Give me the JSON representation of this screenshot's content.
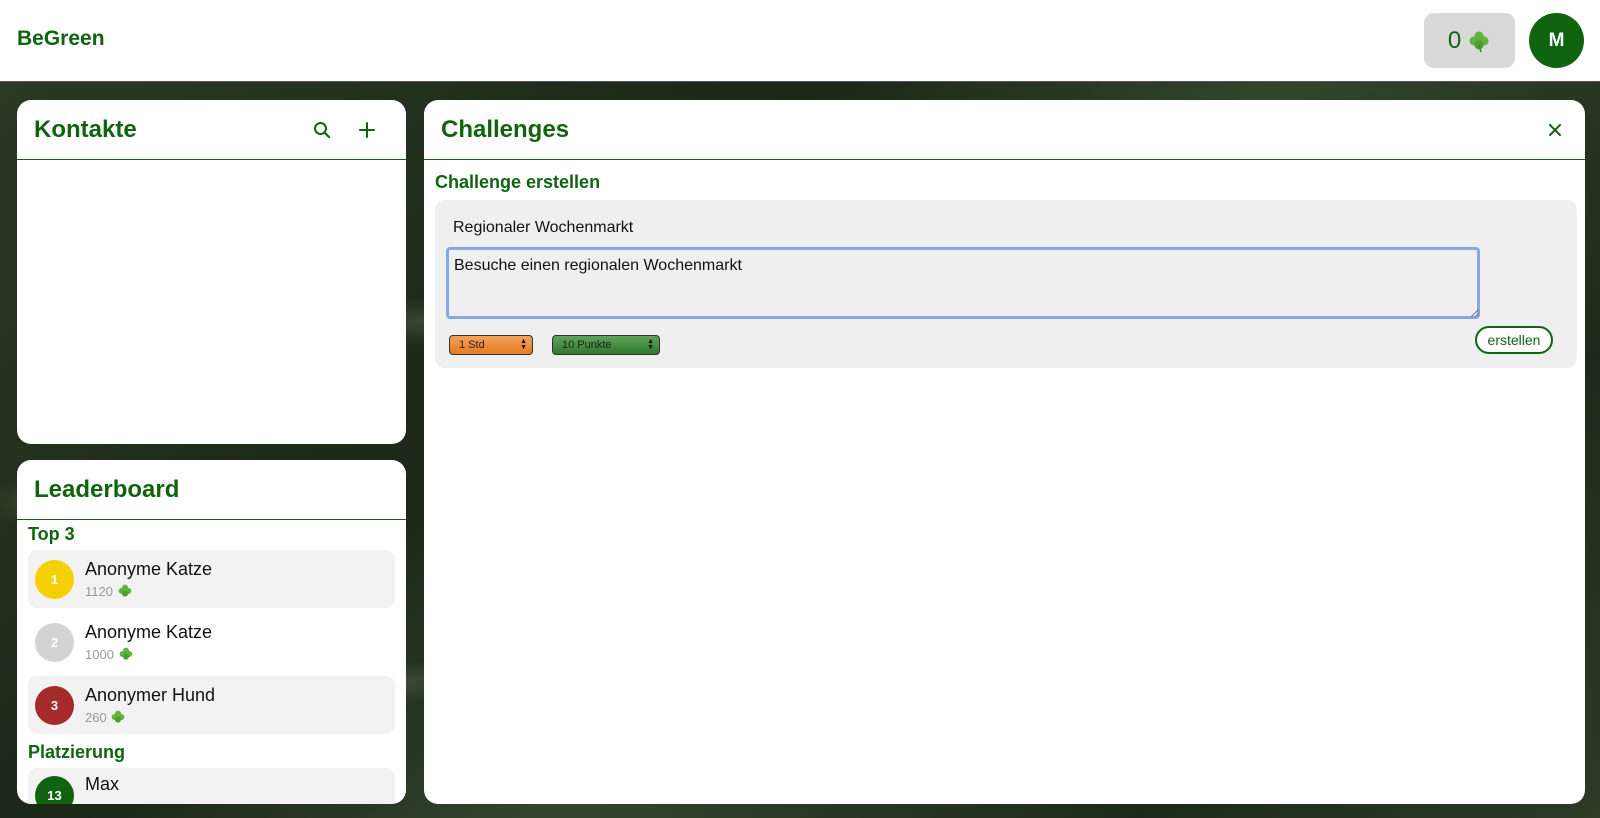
{
  "header": {
    "brand": "BeGreen",
    "points": "0",
    "avatar_initial": "M"
  },
  "contacts": {
    "title": "Kontakte",
    "search_icon": "search-icon",
    "add_icon": "plus-icon"
  },
  "leaderboard": {
    "title": "Leaderboard",
    "top3_title": "Top 3",
    "top3": [
      {
        "rank": "1",
        "name": "Anonyme Katze",
        "points": "1120",
        "color": "#f5d000"
      },
      {
        "rank": "2",
        "name": "Anonyme Katze",
        "points": "1000",
        "color": "#d3d3d3"
      },
      {
        "rank": "3",
        "name": "Anonymer Hund",
        "points": "260",
        "color": "#a52a2a"
      }
    ],
    "placement_title": "Platzierung",
    "placement": [
      {
        "rank": "13",
        "name": "Max",
        "color": "#11640f"
      }
    ]
  },
  "challenges": {
    "title": "Challenges",
    "close_icon": "close-icon",
    "create_title": "Challenge erstellen",
    "form": {
      "title_value": "Regionaler Wochenmarkt",
      "description_value": "Besuche einen regionalen Wochenmarkt",
      "duration": "1 Std",
      "points": "10 Punkte",
      "submit_label": "erstellen"
    }
  },
  "colors": {
    "brand_green": "#11640f",
    "duration_orange": "#e57a23",
    "points_green": "#2f7a2b"
  }
}
